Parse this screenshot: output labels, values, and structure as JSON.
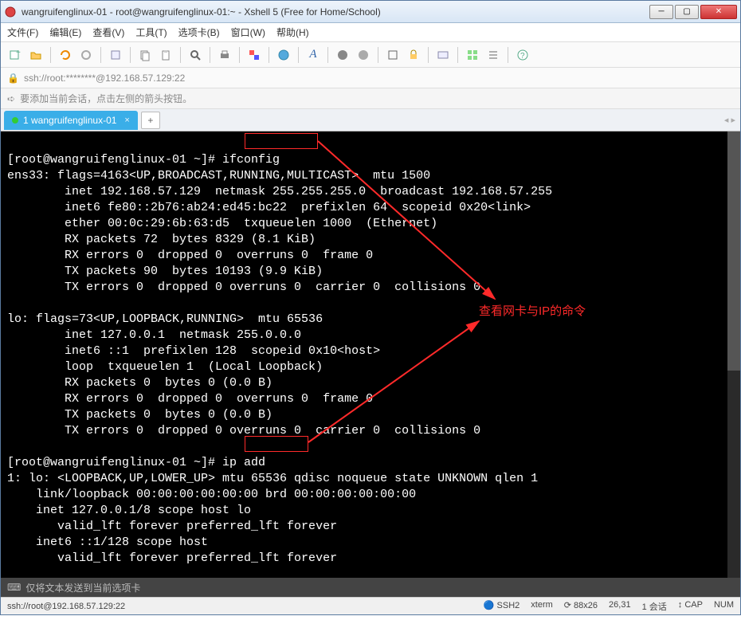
{
  "title": "wangruifenglinux-01 - root@wangruifenglinux-01:~ - Xshell 5 (Free for Home/School)",
  "menu": [
    "文件(F)",
    "编辑(E)",
    "查看(V)",
    "工具(T)",
    "选项卡(B)",
    "窗口(W)",
    "帮助(H)"
  ],
  "address": "ssh://root:********@192.168.57.129:22",
  "hint": "要添加当前会话，点击左侧的箭头按钮。",
  "tab": {
    "label": "1 wangruifenglinux-01"
  },
  "prompt1": "[root@wangruifenglinux-01 ~]#",
  "cmd1": " ifconfig",
  "out1a": "ens33: flags=4163<UP,BROADCAST,RUNNING,MULTICAST>  mtu 1500",
  "out1b": "        inet 192.168.57.129  netmask 255.255.255.0  broadcast 192.168.57.255",
  "out1c": "        inet6 fe80::2b76:ab24:ed45:bc22  prefixlen 64  scopeid 0x20<link>",
  "out1d": "        ether 00:0c:29:6b:63:d5  txqueuelen 1000  (Ethernet)",
  "out1e": "        RX packets 72  bytes 8329 (8.1 KiB)",
  "out1f": "        RX errors 0  dropped 0  overruns 0  frame 0",
  "out1g": "        TX packets 90  bytes 10193 (9.9 KiB)",
  "out1h": "        TX errors 0  dropped 0 overruns 0  carrier 0  collisions 0",
  "out2a": "lo: flags=73<UP,LOOPBACK,RUNNING>  mtu 65536",
  "out2b": "        inet 127.0.0.1  netmask 255.0.0.0",
  "out2c": "        inet6 ::1  prefixlen 128  scopeid 0x10<host>",
  "out2d": "        loop  txqueuelen 1  (Local Loopback)",
  "out2e": "        RX packets 0  bytes 0 (0.0 B)",
  "out2f": "        RX errors 0  dropped 0  overruns 0  frame 0",
  "out2g": "        TX packets 0  bytes 0 (0.0 B)",
  "out2h": "        TX errors 0  dropped 0 overruns 0  carrier 0  collisions 0",
  "prompt2": "[root@wangruifenglinux-01 ~]#",
  "cmd2": " ip add",
  "out3a": "1: lo: <LOOPBACK,UP,LOWER_UP> mtu 65536 qdisc noqueue state UNKNOWN qlen 1",
  "out3b": "    link/loopback 00:00:00:00:00:00 brd 00:00:00:00:00:00",
  "out3c": "    inet 127.0.0.1/8 scope host lo",
  "out3d": "       valid_lft forever preferred_lft forever",
  "out3e": "    inet6 ::1/128 scope host",
  "out3f": "       valid_lft forever preferred_lft forever",
  "annotation": "查看网卡与IP的命令",
  "status1": "仅将文本发送到当前选项卡",
  "status2_left": "ssh://root@192.168.57.129:22",
  "status2_right": [
    "SSH2",
    "xterm",
    "88x26",
    "26,31",
    "1 会话",
    "CAP",
    "NUM"
  ],
  "icons": {
    "lock": "🔒",
    "plus": "+",
    "arrow": "➪",
    "dot": "●"
  }
}
